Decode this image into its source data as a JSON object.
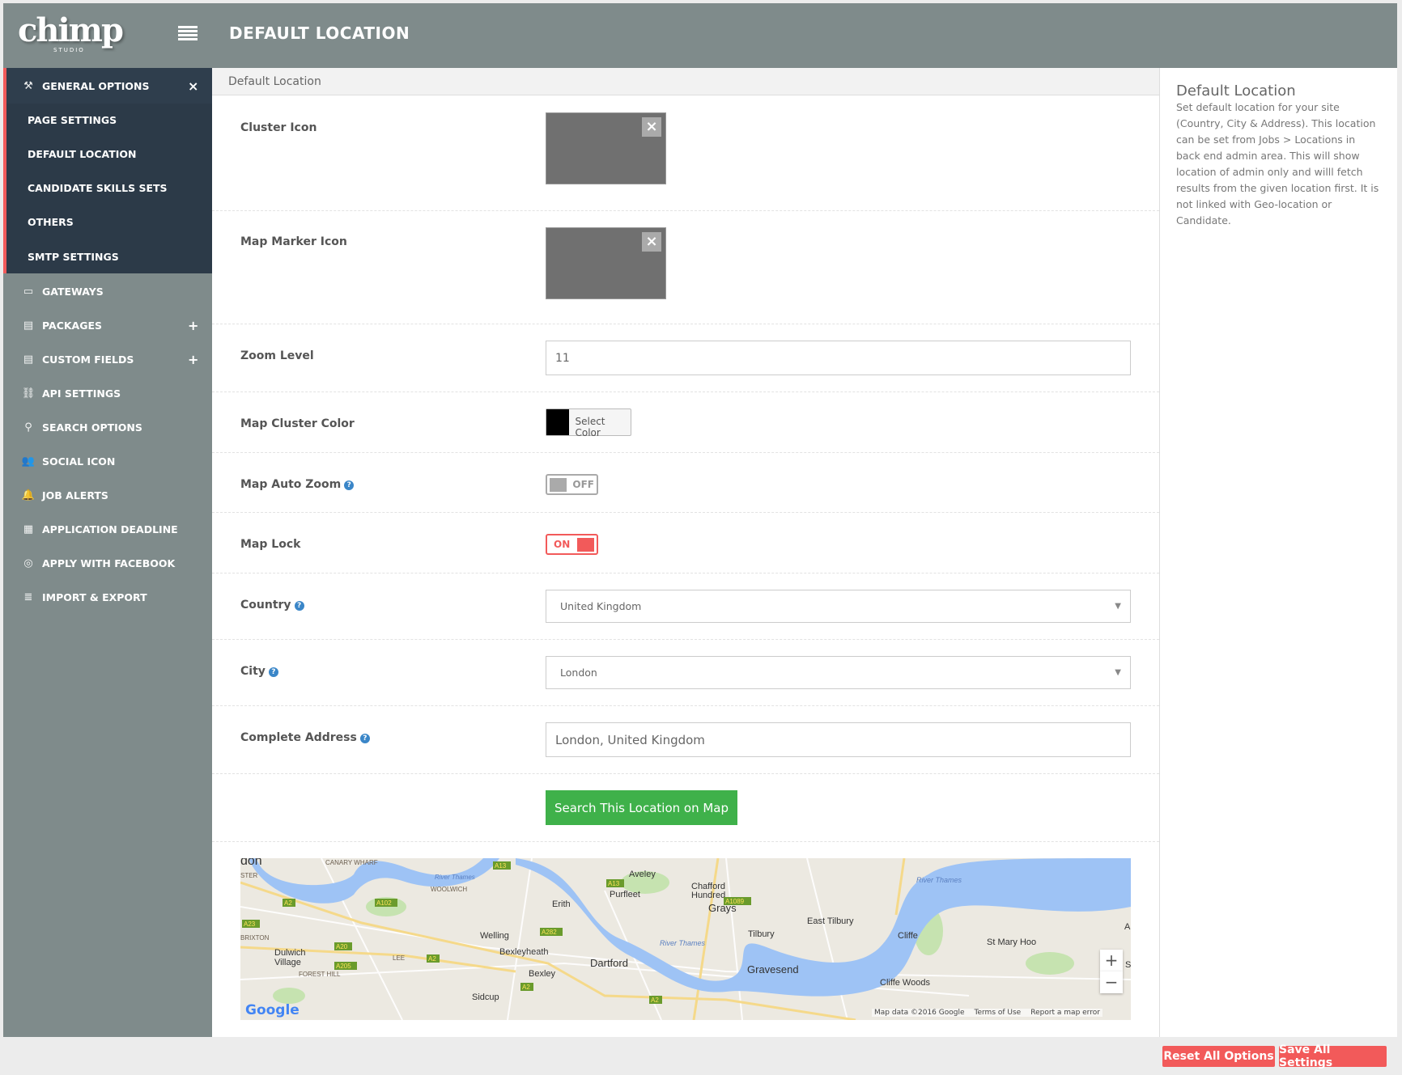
{
  "header": {
    "logo": "chimp",
    "logo_sub": "STUDIO",
    "title": "DEFAULT LOCATION"
  },
  "sidebar": {
    "general": {
      "label": "GENERAL OPTIONS",
      "close": "×",
      "sub": [
        {
          "label": "PAGE SETTINGS"
        },
        {
          "label": "DEFAULT LOCATION"
        },
        {
          "label": "CANDIDATE SKILLS SETS"
        },
        {
          "label": "OTHERS"
        },
        {
          "label": "SMTP SETTINGS"
        }
      ]
    },
    "items": [
      {
        "label": "GATEWAYS",
        "icon": "wallet-icon",
        "glyph": "▭"
      },
      {
        "label": "PACKAGES",
        "icon": "credit-card-icon",
        "glyph": "▤",
        "expand": "+"
      },
      {
        "label": "CUSTOM FIELDS",
        "icon": "form-icon",
        "glyph": "▤",
        "expand": "+"
      },
      {
        "label": "API SETTINGS",
        "icon": "link-icon",
        "glyph": "⛓"
      },
      {
        "label": "SEARCH OPTIONS",
        "icon": "search-icon",
        "glyph": "⚲"
      },
      {
        "label": "SOCIAL ICON",
        "icon": "users-icon",
        "glyph": "👥"
      },
      {
        "label": "JOB ALERTS",
        "icon": "bell-icon",
        "glyph": "🔔"
      },
      {
        "label": "APPLICATION DEADLINE",
        "icon": "calendar-icon",
        "glyph": "▦"
      },
      {
        "label": "APPLY WITH FACEBOOK",
        "icon": "facebook-icon",
        "glyph": "◎"
      },
      {
        "label": "IMPORT & EXPORT",
        "icon": "database-icon",
        "glyph": "≣"
      }
    ]
  },
  "breadcrumb": "Default Location",
  "form": {
    "cluster_icon": {
      "label": "Cluster Icon",
      "remove": "×"
    },
    "map_marker_icon": {
      "label": "Map Marker Icon",
      "remove": "×"
    },
    "zoom_level": {
      "label": "Zoom Level",
      "value": "11"
    },
    "map_cluster_color": {
      "label": "Map Cluster Color",
      "button": "Select Color",
      "color": "#000000"
    },
    "map_auto_zoom": {
      "label": "Map Auto Zoom",
      "state": "OFF"
    },
    "map_lock": {
      "label": "Map Lock",
      "state": "ON"
    },
    "country": {
      "label": "Country",
      "value": "United Kingdom"
    },
    "city": {
      "label": "City",
      "value": "London"
    },
    "address": {
      "label": "Complete Address",
      "value": "London, United Kingdom"
    },
    "search_button": "Search This Location on Map",
    "help": "?"
  },
  "map": {
    "labels": [
      "don",
      "CANARY WHARF",
      "STER",
      "WOOLWICH",
      "River Thames",
      "Aveley",
      "Purfleet",
      "Chafford",
      "Hundred",
      "Grays",
      "Erith",
      "East Tilbury",
      "Tilbury",
      "Cliffe",
      "St Mary Hoo",
      "BRIXTON",
      "Dulwich",
      "Village",
      "Welling",
      "Bexleyheath",
      "LEE",
      "FOREST HILL",
      "Dartford",
      "Bexley",
      "Gravesend",
      "Cliffe Woods",
      "Sidcup",
      "River Thames",
      "River Thames",
      "Al",
      "S"
    ],
    "roads": [
      "A13",
      "A13",
      "A2",
      "A102",
      "A1089",
      "A23",
      "A282",
      "A20",
      "A2",
      "A205",
      "A2",
      "A2"
    ],
    "zoom_in": "+",
    "zoom_out": "−",
    "brand": "Google",
    "attribution": "Map data ©2016 Google",
    "terms": "Terms of Use",
    "report": "Report a map error"
  },
  "help_panel": {
    "title": "Default Location",
    "text": "Set default location for your site (Country, City & Address). This location can be set from Jobs > Locations in back end admin area. This will show location of admin only and willl fetch results from the given location first. It is not linked with Geo-location or Candidate."
  },
  "footer": {
    "reset": "Reset All Options",
    "save": "Save All Settings"
  },
  "colors": {
    "accent": "#f25a5a",
    "header": "#7f8b8b",
    "sidebar_dark": "#2c3a48",
    "search_button": "#3fb14a",
    "help": "#3a86c8"
  }
}
